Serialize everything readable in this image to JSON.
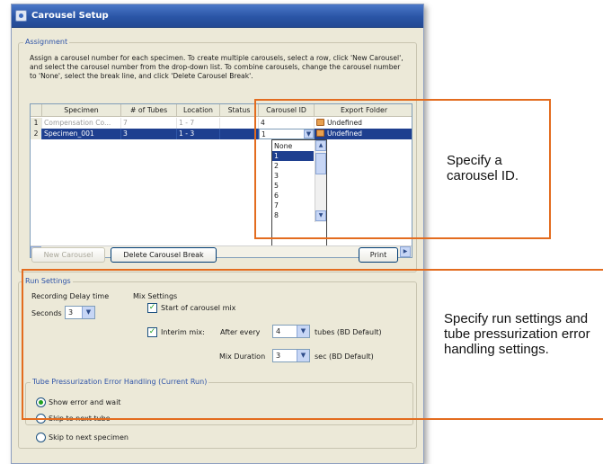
{
  "window": {
    "title": "Carousel Setup",
    "icon": "carousel-icon"
  },
  "assignment": {
    "legend": "Assignment",
    "instructions": "Assign a carousel number for each specimen.  To create multiple carousels, select a row, click 'New Carousel', and select the carousel number from the drop-down list. To combine carousels, change the carousel number to 'None', select the break line, and click 'Delete Carousel Break'.",
    "columns": [
      "",
      "Specimen",
      "# of Tubes",
      "Location",
      "Status",
      "Carousel ID",
      "Export Folder"
    ],
    "rows": [
      {
        "index": "1",
        "specimen": "Compensation Co...",
        "tubes": "7",
        "location": "1 - 7",
        "status": "",
        "carousel_id": "4",
        "export_folder": "Undefined"
      },
      {
        "index": "2",
        "specimen": "Specimen_001",
        "tubes": "3",
        "location": "1 - 3",
        "status": "",
        "carousel_id": "1",
        "export_folder": "Undefined"
      }
    ],
    "dropdown_options": [
      "None",
      "1",
      "2",
      "3",
      "5",
      "6",
      "7",
      "8"
    ],
    "dropdown_selected": "1",
    "buttons": {
      "new_carousel": "New Carousel",
      "delete_break": "Delete Carousel Break",
      "print": "Print"
    }
  },
  "run_settings": {
    "legend": "Run Settings",
    "recording_delay_label": "Recording Delay time",
    "seconds_label": "Seconds",
    "seconds_value": "3",
    "mix_settings_label": "Mix Settings",
    "start_mix_label": "Start of carousel mix",
    "start_mix_checked": true,
    "interim_mix_label": "Interim mix:",
    "interim_mix_checked": true,
    "after_every_label": "After every",
    "after_every_value": "4",
    "tubes_label": "tubes (BD Default)",
    "mix_duration_label": "Mix Duration",
    "mix_duration_value": "3",
    "sec_label": "sec (BD Default)"
  },
  "pressurization": {
    "legend": "Tube Pressurization Error Handling (Current Run)",
    "options": [
      "Show error and wait",
      "Skip to next tube",
      "Skip to next specimen"
    ],
    "selected": "Show error and wait"
  },
  "callouts": {
    "carousel_id": "Specify a carousel ID.",
    "run_settings": "Specify run settings and tube pressurization error handling settings."
  },
  "colors": {
    "accent": "#e36c1f",
    "selection": "#1e3f8f",
    "title_bar": "#2a55a6",
    "check": "#21a121"
  }
}
